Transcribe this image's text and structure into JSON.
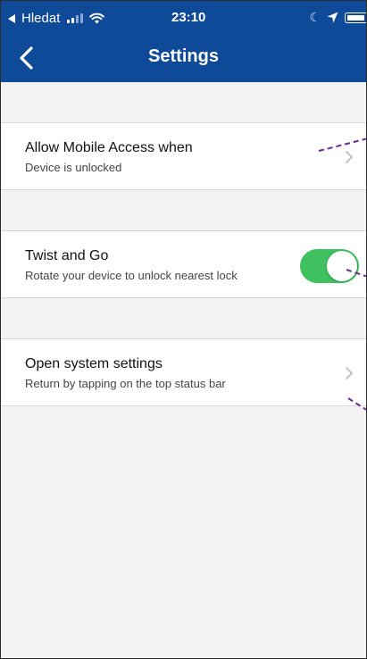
{
  "status_bar": {
    "back_app": "Hledat",
    "time": "23:10",
    "icons": [
      "back-triangle-icon",
      "signal-icon",
      "wifi-icon",
      "moon-icon",
      "location-arrow-icon",
      "battery-icon"
    ]
  },
  "nav": {
    "title": "Settings",
    "back_icon": "chevron-left-icon"
  },
  "rows": [
    {
      "title": "Allow Mobile Access when",
      "subtitle": "Device is unlocked",
      "accessory": "chevron-right-icon"
    },
    {
      "title": "Twist and Go",
      "subtitle": "Rotate your device to unlock nearest lock",
      "accessory": "toggle",
      "toggle_on": true
    },
    {
      "title": "Open system settings",
      "subtitle": "Return by tapping on the top status bar",
      "accessory": "chevron-right-icon"
    }
  ],
  "colors": {
    "header": "#0f4a98",
    "background": "#f2f2f2",
    "toggle_on": "#3fc160",
    "annotation": "#6a2c91"
  }
}
